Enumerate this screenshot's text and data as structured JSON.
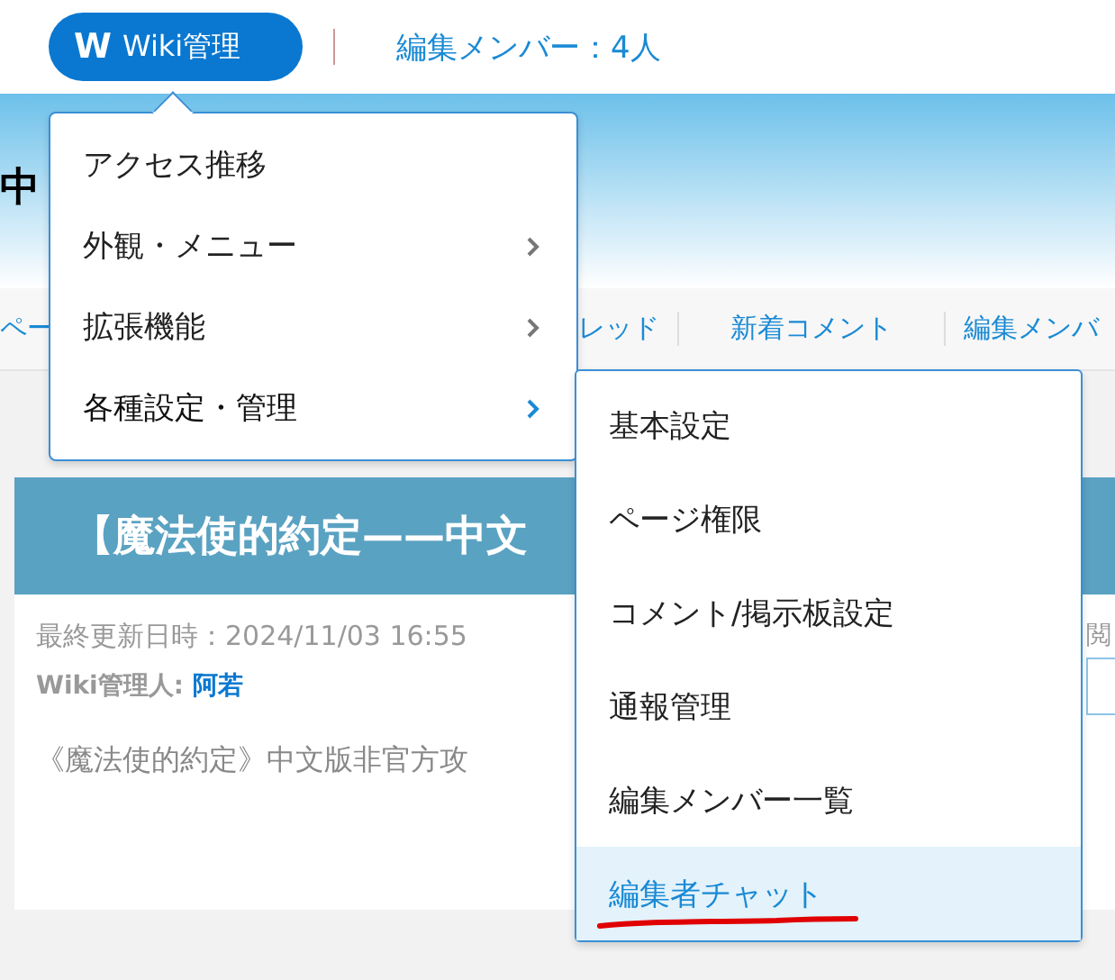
{
  "header": {
    "logo": "W",
    "wiki_button": "Wiki管理",
    "member_link": "編集メンバー：4人"
  },
  "site_title": "中",
  "nav": [
    "ペー",
    "レッド",
    "新着コメント",
    "編集メンバ"
  ],
  "page": {
    "title": "【魔法使的約定——中文",
    "updated": "最終更新日時：2024/11/03 16:55",
    "admin_label": "Wiki管理人:",
    "admin_name": "阿若",
    "intro": "《魔法使的約定》中文版非官方攻",
    "side_label": "閲"
  },
  "menu": {
    "items": [
      {
        "label": "アクセス推移",
        "kind": "link",
        "expanded": false
      },
      {
        "label": "外観・メニュー",
        "kind": "submenu",
        "expanded": false
      },
      {
        "label": "拡張機能",
        "kind": "submenu",
        "expanded": false
      },
      {
        "label": "各種設定・管理",
        "kind": "submenu",
        "expanded": true
      }
    ]
  },
  "submenu": {
    "items": [
      {
        "label": "基本設定",
        "selected": false
      },
      {
        "label": "ページ権限",
        "selected": false
      },
      {
        "label": "コメント/掲示板設定",
        "selected": false
      },
      {
        "label": "通報管理",
        "selected": false
      },
      {
        "label": "編集メンバー一覧",
        "selected": false
      },
      {
        "label": "編集者チャット",
        "selected": true,
        "underlined": true
      }
    ]
  }
}
